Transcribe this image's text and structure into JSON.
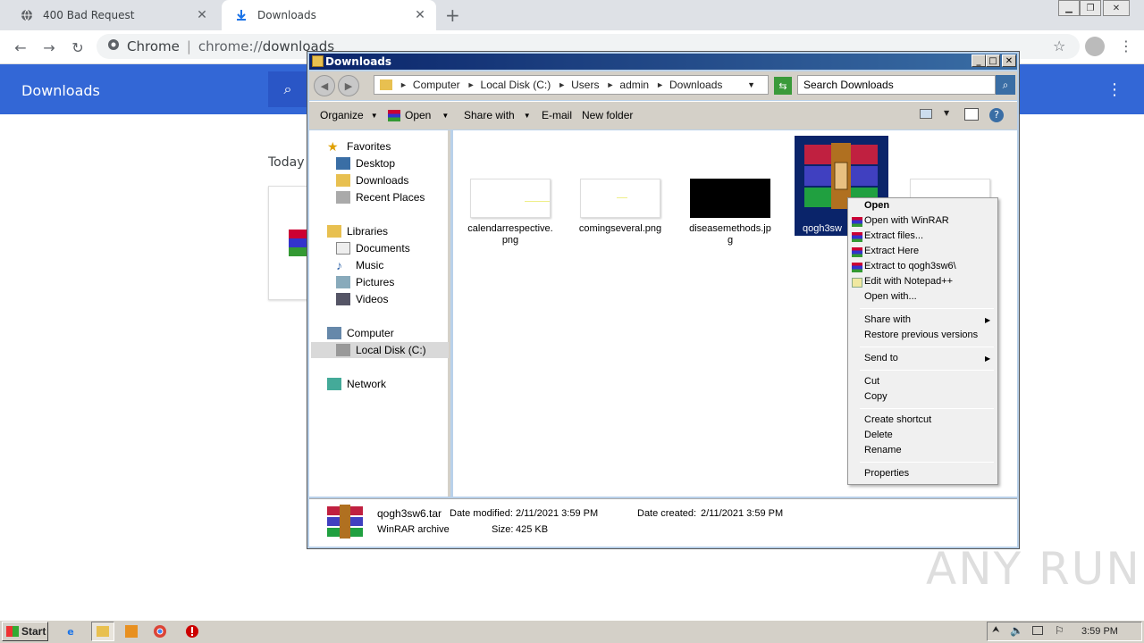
{
  "chrome": {
    "tabs": [
      {
        "title": "400 Bad Request",
        "icon": "globe-icon"
      },
      {
        "title": "Downloads",
        "icon": "download-icon"
      }
    ],
    "new_tab": "+",
    "omnibox": {
      "site": "Chrome",
      "url_prefix": "chrome://",
      "url_path": "downloads"
    }
  },
  "downloads_page": {
    "title": "Downloads",
    "section": "Today"
  },
  "explorer": {
    "title": "Downloads",
    "breadcrumb": [
      "Computer",
      "Local Disk (C:)",
      "Users",
      "admin",
      "Downloads"
    ],
    "search_placeholder": "Search Downloads",
    "commands": [
      "Organize",
      "Open",
      "Share with",
      "E-mail",
      "New folder"
    ],
    "nav": {
      "favorites": "Favorites",
      "favorites_items": [
        "Desktop",
        "Downloads",
        "Recent Places"
      ],
      "libraries": "Libraries",
      "libraries_items": [
        "Documents",
        "Music",
        "Pictures",
        "Videos"
      ],
      "computer": "Computer",
      "computer_items": [
        "Local Disk (C:)"
      ],
      "network": "Network"
    },
    "files": [
      {
        "name_line1": "calendarrespective.",
        "name_line2": "png"
      },
      {
        "name_line1": "comingseveral.png",
        "name_line2": ""
      },
      {
        "name_line1": "diseasemethods.jp",
        "name_line2": "g"
      },
      {
        "name_line1": "qogh3sw",
        "name_line2": ""
      }
    ],
    "details": {
      "name": "qogh3sw6.tar",
      "type": "WinRAR archive",
      "modified_label": "Date modified:",
      "modified": "2/11/2021 3:59 PM",
      "created_label": "Date created:",
      "created": "2/11/2021 3:59 PM",
      "size_label": "Size:",
      "size": "425 KB"
    }
  },
  "context_menu": {
    "items": [
      "Open",
      "Open with WinRAR",
      "Extract files...",
      "Extract Here",
      "Extract to qogh3sw6\\",
      "Edit with Notepad++",
      "Open with...",
      "Share with",
      "Restore previous versions",
      "Send to",
      "Cut",
      "Copy",
      "Create shortcut",
      "Delete",
      "Rename",
      "Properties"
    ]
  },
  "taskbar": {
    "start": "Start",
    "clock": "3:59 PM"
  },
  "watermark": "ANY RUN"
}
